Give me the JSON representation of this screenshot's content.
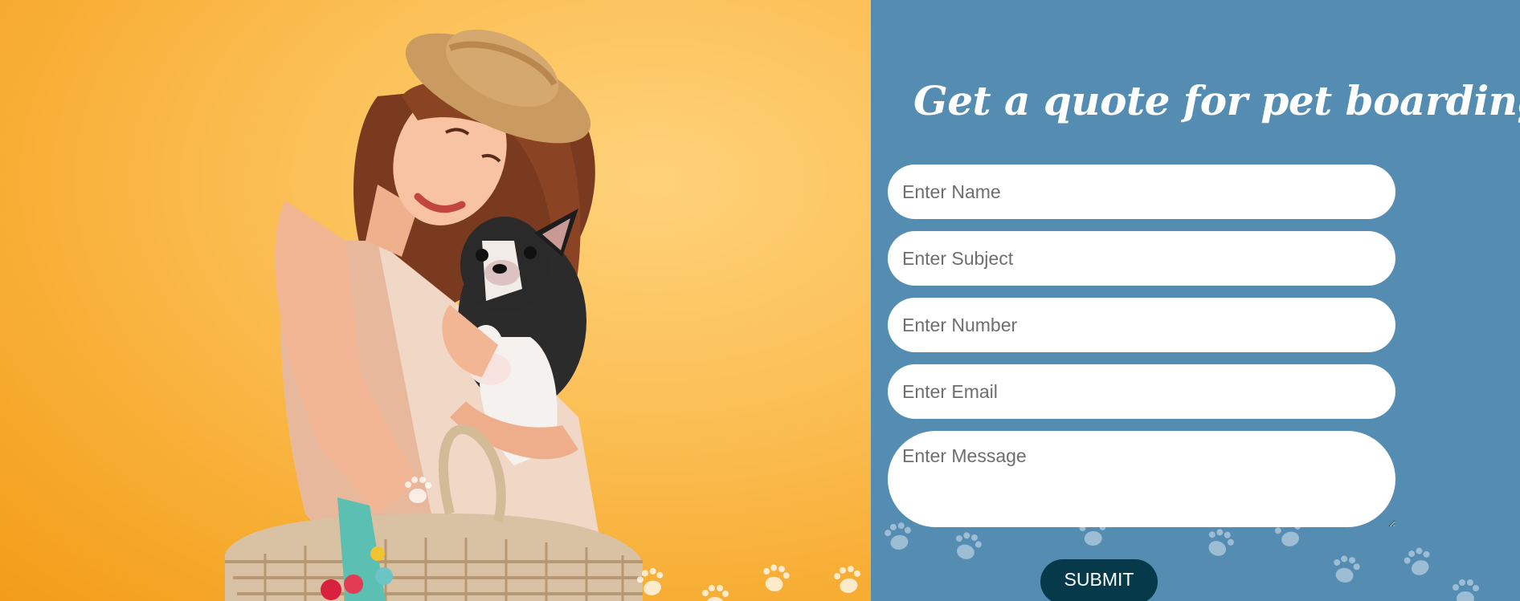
{
  "hero": {
    "image": "woman-hugging-dog-photo",
    "accent_color": "#f6a82a"
  },
  "quote_form": {
    "title": "Get a quote for pet boarding",
    "fields": {
      "name": {
        "placeholder": "Enter Name",
        "value": ""
      },
      "subject": {
        "placeholder": "Enter Subject",
        "value": ""
      },
      "number": {
        "placeholder": "Enter Number",
        "value": ""
      },
      "email": {
        "placeholder": "Enter Email",
        "value": ""
      },
      "message": {
        "placeholder": "Enter Message",
        "value": ""
      }
    },
    "submit_label": "SUBMIT"
  },
  "colors": {
    "panel_bg": "#558db2",
    "button_bg": "#063a4a",
    "field_bg": "#ffffff",
    "paw_decoration": "#a9c6da"
  }
}
